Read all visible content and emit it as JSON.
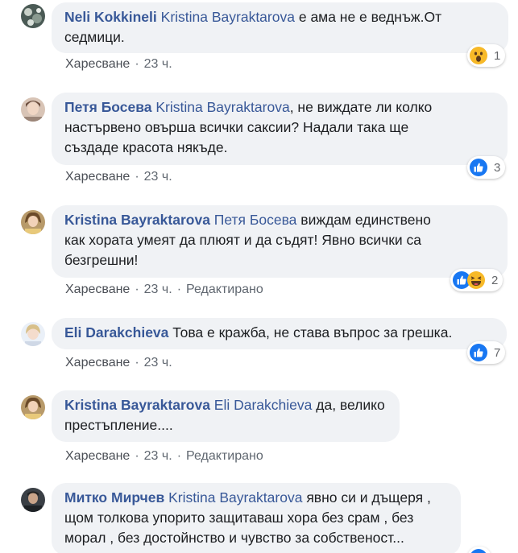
{
  "comments": [
    {
      "author": "Neli Kokkineli",
      "mention": "Kristina Bayraktarova",
      "text_lines": [
        "е ама не е веднъж.От",
        "седмици."
      ],
      "like": "Харесване",
      "time": "23 ч.",
      "edited": "",
      "reactions": [
        "wow"
      ],
      "count": "1"
    },
    {
      "author": "Петя Босева",
      "mention": "Kristina Bayraktarova",
      "text_lines": [
        ", не виждате ли колко",
        "настървено овърша всички саксии? Надали така ще",
        "създаде красота някъде."
      ],
      "like": "Харесване",
      "time": "23 ч.",
      "edited": "",
      "reactions": [
        "like"
      ],
      "count": "3"
    },
    {
      "author": "Kristina Bayraktarova",
      "mention": "Петя Босева",
      "text_lines": [
        "виждам единствено",
        "как хората умеят да плюят и да съдят! Явно всички са",
        "безгрешни!"
      ],
      "like": "Харесване",
      "time": "23 ч.",
      "edited": "Редактирано",
      "reactions": [
        "like",
        "haha"
      ],
      "count": "2"
    },
    {
      "author": "Eli Darakchieva",
      "mention": "",
      "text_lines": [
        "Това е кражба, не става въпрос за грешка."
      ],
      "like": "Харесване",
      "time": "23 ч.",
      "edited": "",
      "reactions": [
        "like"
      ],
      "count": "7"
    },
    {
      "author": "Kristina Bayraktarova",
      "mention": "Eli Darakchieva",
      "text_lines": [
        "да, велико",
        "престъпление...."
      ],
      "like": "Харесване",
      "time": "23 ч.",
      "edited": "Редактирано",
      "reactions": [],
      "count": ""
    },
    {
      "author": "Митко Мирчев",
      "mention": "Kristina Bayraktarova",
      "text_lines": [
        "явно си и дъщеря ,",
        "щом толкова упорито защитаваш хора без срам , без",
        "морал , без достойнство и чувство за собственост..."
      ],
      "like": "",
      "time": "",
      "edited": "",
      "reactions": [],
      "count": ""
    }
  ],
  "colors": {
    "link": "#385898",
    "bubble": "#f0f2f5",
    "like_blue": "#1877f2",
    "haha_yellow": "#f7b928"
  },
  "icons": {
    "like": "like-reaction-icon",
    "wow": "wow-reaction-icon",
    "haha": "haha-reaction-icon"
  }
}
